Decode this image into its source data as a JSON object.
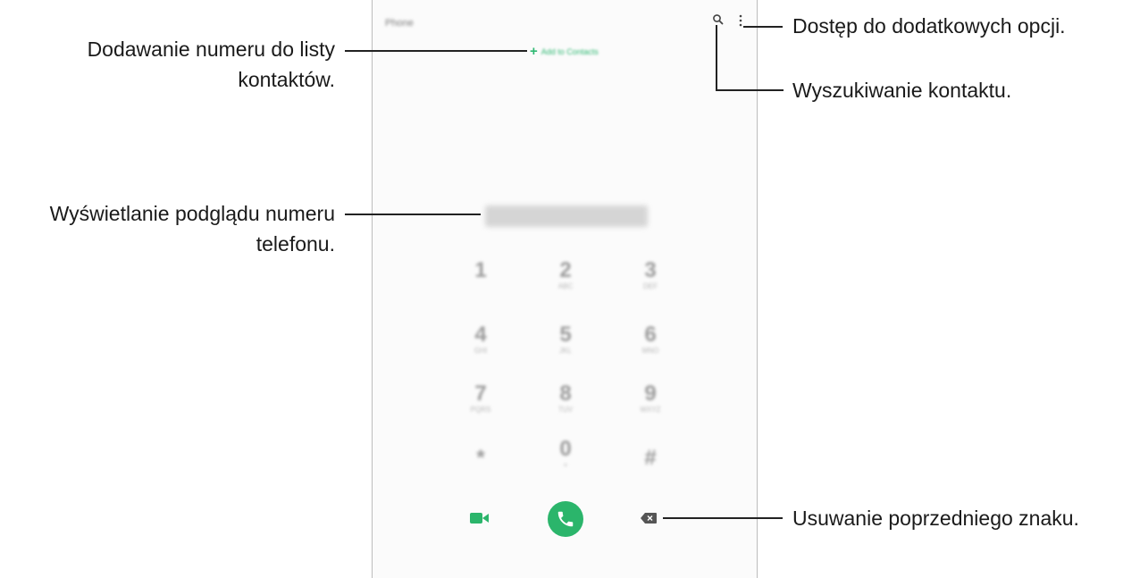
{
  "phone": {
    "app_title": "Phone",
    "add_contact_label": "Add to Contacts",
    "keypad": [
      {
        "digit": "1",
        "sub": ""
      },
      {
        "digit": "2",
        "sub": "ABC"
      },
      {
        "digit": "3",
        "sub": "DEF"
      },
      {
        "digit": "4",
        "sub": "GHI"
      },
      {
        "digit": "5",
        "sub": "JKL"
      },
      {
        "digit": "6",
        "sub": "MNO"
      },
      {
        "digit": "7",
        "sub": "PQRS"
      },
      {
        "digit": "8",
        "sub": "TUV"
      },
      {
        "digit": "9",
        "sub": "WXYZ"
      },
      {
        "digit": "*",
        "sub": ""
      },
      {
        "digit": "0",
        "sub": "+"
      },
      {
        "digit": "#",
        "sub": ""
      }
    ],
    "accent_color": "#2bb56b"
  },
  "callouts": {
    "add_contact_line1": "Dodawanie numeru do listy",
    "add_contact_line2": "kontaktów.",
    "preview_line1": "Wyświetlanie podglądu numeru",
    "preview_line2": "telefonu.",
    "more_options": "Dostęp do dodatkowych opcji.",
    "search": "Wyszukiwanie kontaktu.",
    "delete": "Usuwanie poprzedniego znaku."
  },
  "icons": [
    "search-icon",
    "more-options-icon",
    "video-call-icon",
    "phone-icon",
    "backspace-icon",
    "plus-icon"
  ]
}
